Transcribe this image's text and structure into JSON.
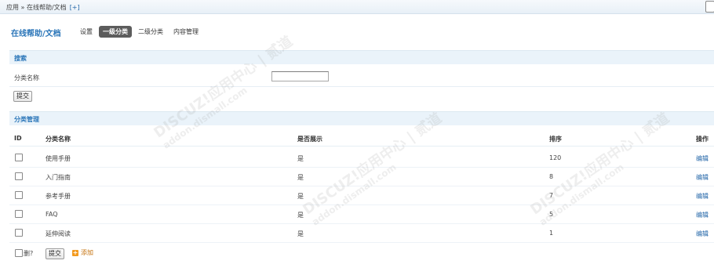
{
  "breadcrumb": {
    "text": "应用 » 在线帮助/文档",
    "add": "[+]"
  },
  "title": "在线帮助/文档",
  "nav": [
    {
      "label": "设置",
      "active": false
    },
    {
      "label": "一级分类",
      "active": true
    },
    {
      "label": "二级分类",
      "active": false
    },
    {
      "label": "内容管理",
      "active": false
    }
  ],
  "search": {
    "heading": "搜索",
    "field_label": "分类名称",
    "value": "",
    "submit": "提交"
  },
  "manage": {
    "heading": "分类管理",
    "columns": {
      "id": "ID",
      "name": "分类名称",
      "visible": "是否展示",
      "order": "排序",
      "action": "操作"
    },
    "rows": [
      {
        "name": "使用手册",
        "visible": "是",
        "order": "120",
        "action": "编辑"
      },
      {
        "name": "入门指南",
        "visible": "是",
        "order": "8",
        "action": "编辑"
      },
      {
        "name": "参考手册",
        "visible": "是",
        "order": "7",
        "action": "编辑"
      },
      {
        "name": "FAQ",
        "visible": "是",
        "order": "5",
        "action": "编辑"
      },
      {
        "name": "延伸阅读",
        "visible": "是",
        "order": "1",
        "action": "编辑"
      }
    ],
    "delete_label": "删?",
    "submit": "提交",
    "add": "添加"
  },
  "watermark": {
    "brand": "DISCUZ!应用中心 | 贰道",
    "site": "addon.dismall.com"
  }
}
